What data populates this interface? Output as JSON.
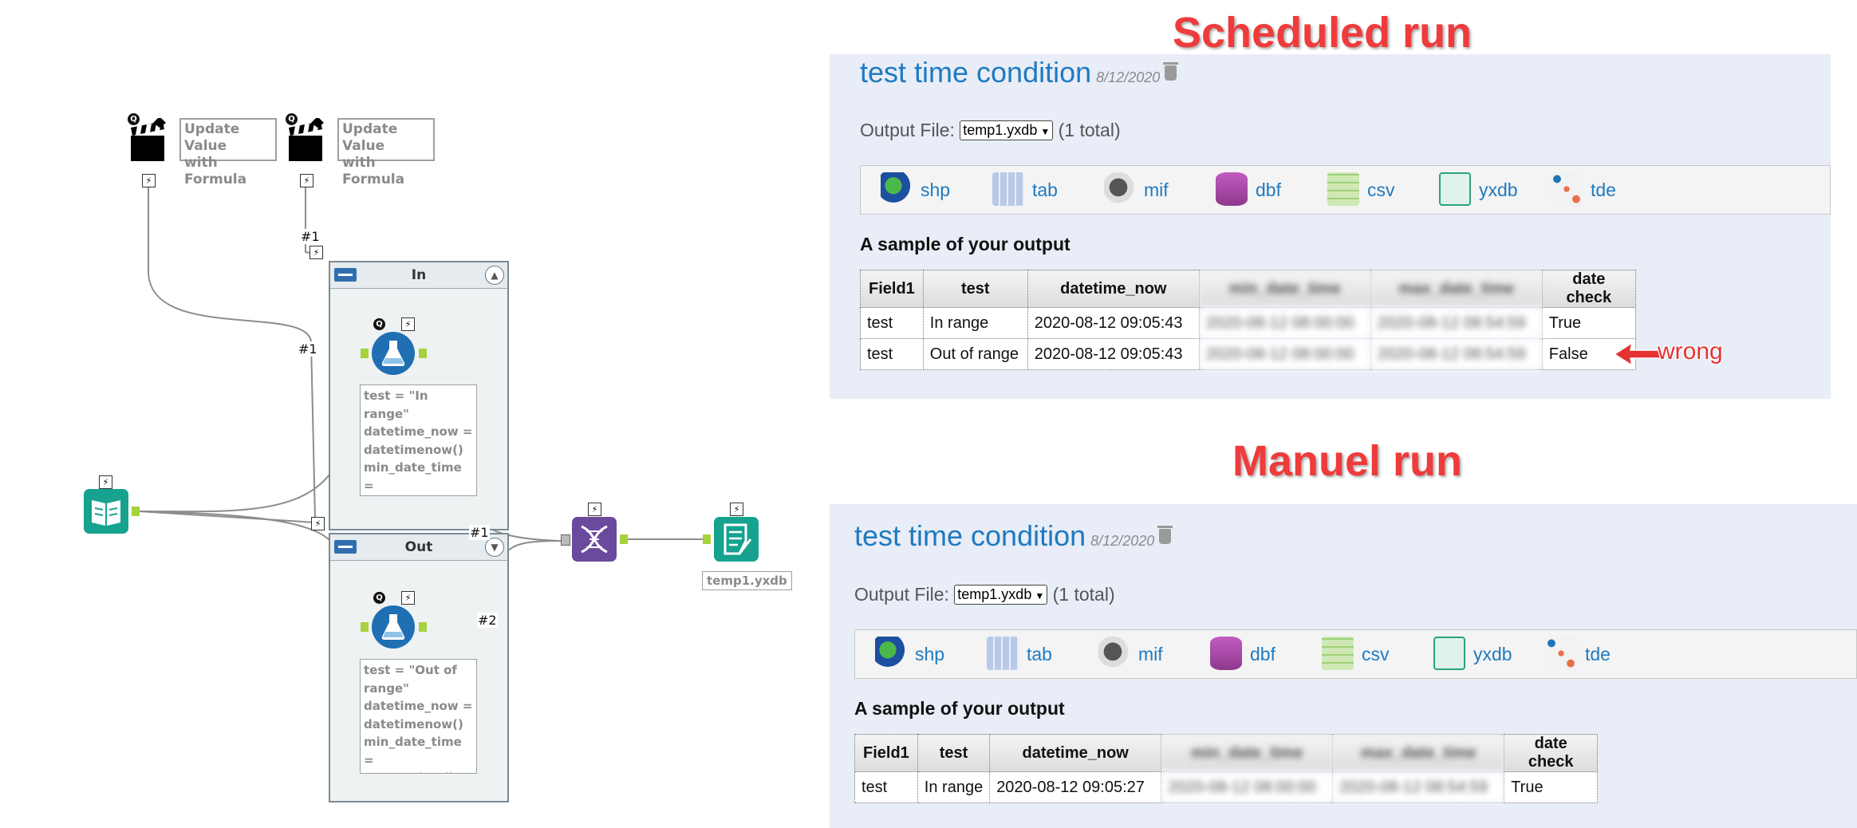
{
  "workflow": {
    "action_tools": [
      {
        "label": "Update Value\nwith Formula",
        "badge": "Q",
        "bolt": "⚡"
      },
      {
        "label": "Update Value\nwith Formula",
        "badge": "Q",
        "bolt": "⚡"
      }
    ],
    "wire_labels": {
      "hash1_top": "#1",
      "hash1_left": "#1",
      "hash1_out": "#1",
      "hash2": "#2"
    },
    "containers": {
      "in": {
        "title": "In",
        "formula_text": "test = \"In range\"\ndatetime_now =\ndatetimenow()\nmin_date_time =\nToDateTime(left\n(d..."
      },
      "out": {
        "title": "Out",
        "formula_text": "test = \"Out of\nrange\"\ndatetime_now =\ndatetimenow()\nmin_date_time =\nToDateTime(le..."
      }
    },
    "output_label": "temp1.yxdb",
    "colors": {
      "input_tool": "#16a28f",
      "formula_tool": "#1f6fb2",
      "union_tool": "#6a4a9c",
      "output_tool": "#16a28f"
    }
  },
  "annotations": {
    "scheduled": "Scheduled run",
    "manual": "Manuel run",
    "wrong": "wrong"
  },
  "runs": [
    {
      "title": "test time condition",
      "date": "8/12/2020",
      "output_label": "Output File:",
      "output_file": "temp1.yxdb",
      "total": "(1 total)",
      "formats": [
        "shp",
        "tab",
        "mif",
        "dbf",
        "csv",
        "yxdb",
        "tde"
      ],
      "sample_title": "A sample of your output",
      "columns": [
        "Field1",
        "test",
        "datetime_now",
        "min_date_time",
        "max_date_time",
        "date check"
      ],
      "rows": [
        [
          "test",
          "In range",
          "2020-08-12 09:05:43",
          "2020-08-12 08:00:00",
          "2020-08-12 08:54:59",
          "True"
        ],
        [
          "test",
          "Out of range",
          "2020-08-12 09:05:43",
          "2020-08-12 08:00:00",
          "2020-08-12 08:54:59",
          "False"
        ]
      ]
    },
    {
      "title": "test time condition",
      "date": "8/12/2020",
      "output_label": "Output File:",
      "output_file": "temp1.yxdb",
      "total": "(1 total)",
      "formats": [
        "shp",
        "tab",
        "mif",
        "dbf",
        "csv",
        "yxdb",
        "tde"
      ],
      "sample_title": "A sample of your output",
      "columns": [
        "Field1",
        "test",
        "datetime_now",
        "min_date_time",
        "max_date_time",
        "date check"
      ],
      "rows": [
        [
          "test",
          "In range",
          "2020-08-12 09:05:27",
          "2020-08-12 08:00:00",
          "2020-08-12 08:54:59",
          "True"
        ]
      ]
    }
  ]
}
